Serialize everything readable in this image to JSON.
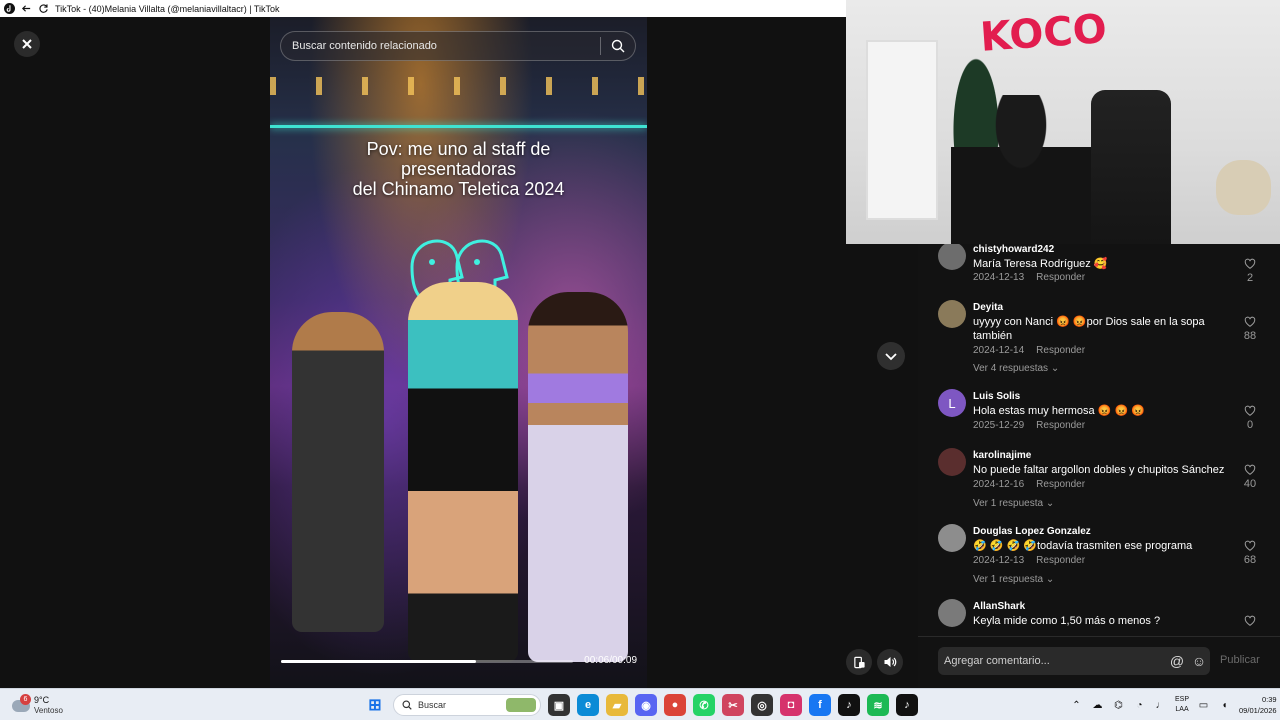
{
  "window": {
    "title": "TikTok - (40)Melania Villalta (@melaniavillaltacr) | TikTok"
  },
  "video": {
    "search_placeholder": "Buscar contenido relacionado",
    "overlay_line1": "Pov: me uno al staff de",
    "overlay_line2": "presentadoras",
    "overlay_line3": "del Chinamo Teletica 2024",
    "time": "00:06/00:09",
    "progress": 0.6667
  },
  "comments": [
    {
      "user": "chistyhoward242",
      "text": "María Teresa Rodríguez 🥰",
      "date": "2024-12-13",
      "reply": "Responder",
      "likes": "2",
      "more": "",
      "avatar_letter": "",
      "avatar_color": "#6d6d6d"
    },
    {
      "user": "Deyita",
      "text": "uyyyy con Nanci 😡 😡por Dios sale en la sopa también",
      "date": "2024-12-14",
      "reply": "Responder",
      "likes": "88",
      "more": "Ver 4 respuestas",
      "avatar_letter": "",
      "avatar_color": "#8a7a5a"
    },
    {
      "user": "Luis Solis",
      "text": "Hola estas muy hermosa 😡 😡 😡",
      "date": "2025-12-29",
      "reply": "Responder",
      "likes": "0",
      "more": "",
      "avatar_letter": "L",
      "avatar_color": "#7e57c2"
    },
    {
      "user": "karolinajime",
      "text": "No puede faltar argollon dobles y chupitos Sánchez",
      "date": "2024-12-16",
      "reply": "Responder",
      "likes": "40",
      "more": "Ver 1 respuesta",
      "avatar_letter": "",
      "avatar_color": "#5a2e2e"
    },
    {
      "user": "Douglas Lopez Gonzalez",
      "text": "🤣 🤣 🤣 🤣todavía trasmiten ese programa",
      "date": "2024-12-13",
      "reply": "Responder",
      "likes": "68",
      "more": "Ver 1 respuesta",
      "avatar_letter": "",
      "avatar_color": "#8d8d8d"
    },
    {
      "user": "AllanShark",
      "text": "Keyla mide como 1,50 más o menos ?",
      "date": "",
      "reply": "",
      "likes": "",
      "more": "",
      "avatar_letter": "",
      "avatar_color": "#7a7a7a"
    }
  ],
  "comment_box": {
    "placeholder": "Agregar comentario...",
    "at_icon": "@",
    "post_label": "Publicar"
  },
  "webcam": {
    "graffiti": "KOCO"
  },
  "taskbar": {
    "weather_temp": "9°C",
    "weather_condition": "Ventoso",
    "weather_badge": "6",
    "search_label": "Buscar",
    "lang_line1": "ESP",
    "lang_line2": "LAA",
    "time": "0:39",
    "date": "09/01/2026",
    "apps": [
      {
        "name": "windows-start",
        "glyph": "⊞",
        "color": "#1a73e8"
      },
      {
        "name": "file-thumbnail",
        "glyph": "",
        "color": "#7ca35a"
      },
      {
        "name": "task-view",
        "glyph": "▣",
        "color": "#333333"
      },
      {
        "name": "edge",
        "glyph": "e",
        "color": "#0c8bd6"
      },
      {
        "name": "file-explorer",
        "glyph": "▰",
        "color": "#e8b93a"
      },
      {
        "name": "discord",
        "glyph": "◉",
        "color": "#5865f2"
      },
      {
        "name": "chrome",
        "glyph": "●",
        "color": "#db4437"
      },
      {
        "name": "whatsapp",
        "glyph": "✆",
        "color": "#25d366"
      },
      {
        "name": "snipping",
        "glyph": "✂",
        "color": "#d0455f"
      },
      {
        "name": "obs",
        "glyph": "◎",
        "color": "#333333"
      },
      {
        "name": "instagram",
        "glyph": "◘",
        "color": "#d6336c"
      },
      {
        "name": "facebook",
        "glyph": "f",
        "color": "#1877f2"
      },
      {
        "name": "tiktok",
        "glyph": "♪",
        "color": "#111111"
      },
      {
        "name": "spotify",
        "glyph": "≋",
        "color": "#1db954"
      },
      {
        "name": "tiktok-active",
        "glyph": "♪",
        "color": "#111111"
      }
    ]
  }
}
